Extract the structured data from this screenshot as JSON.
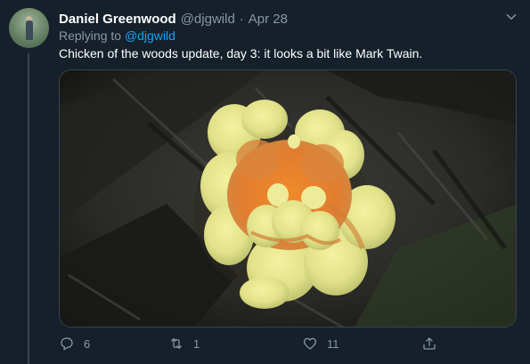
{
  "tweet": {
    "author_name": "Daniel Greenwood",
    "author_handle": "@djgwild",
    "separator": "·",
    "date": "Apr 28",
    "replying_prefix": "Replying to",
    "replying_to": "@djgwild",
    "text": "Chicken of the woods update, day 3: it looks a bit like Mark Twain."
  },
  "actions": {
    "reply_count": "6",
    "retweet_count": "1",
    "like_count": "11"
  },
  "colors": {
    "background": "#15202b",
    "secondary_text": "#8899a6",
    "link": "#1da1f2",
    "border": "#38444d"
  },
  "icons": {
    "caret": "chevron-down-icon",
    "reply": "reply-icon",
    "retweet": "retweet-icon",
    "like": "heart-icon",
    "share": "share-icon"
  }
}
